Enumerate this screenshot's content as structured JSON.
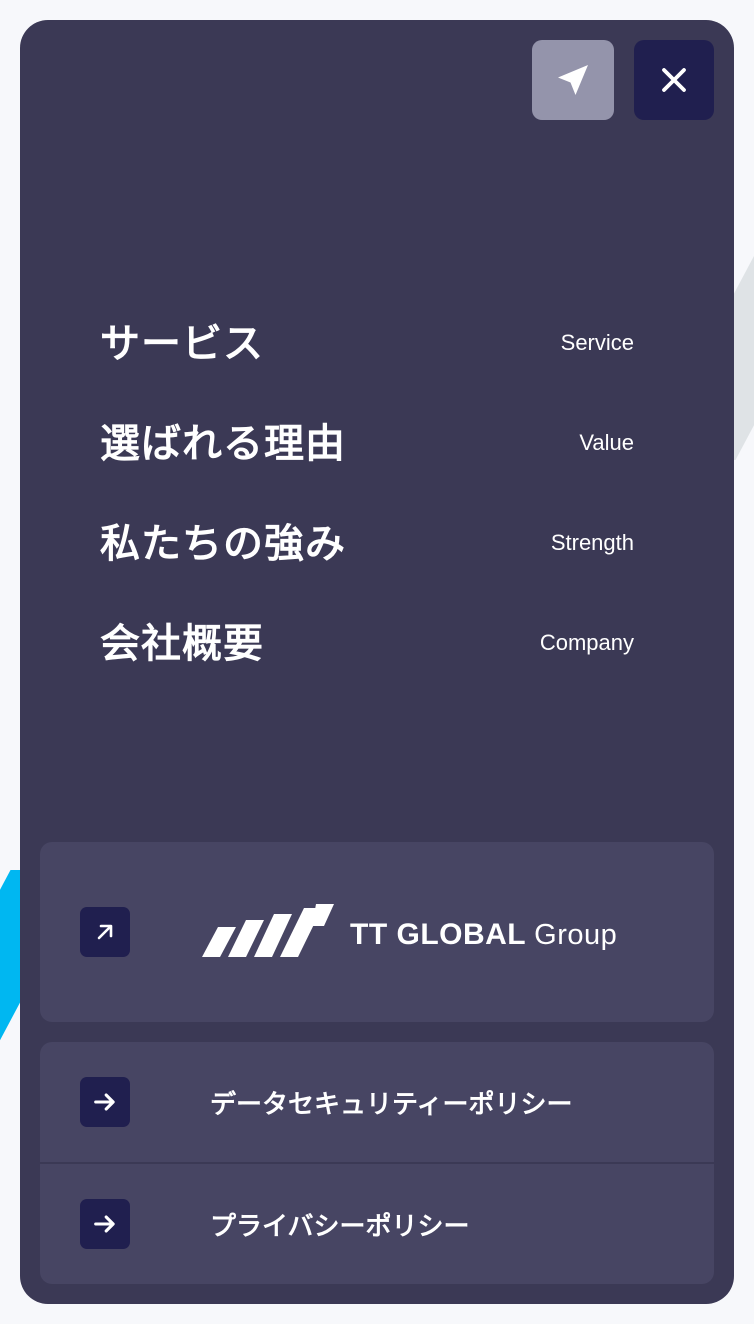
{
  "colors": {
    "panel": "#3b3955",
    "card": "#474563",
    "accent_dark": "#201f4f",
    "send_button": "#9494ab",
    "stripe_blue": "#00b7f1",
    "stripe_grey": "#dfe3e6"
  },
  "header": {
    "send_icon": "paper-plane-icon",
    "close_icon": "close-icon"
  },
  "nav": {
    "items": [
      {
        "jp": "サービス",
        "en": "Service"
      },
      {
        "jp": "選ばれる理由",
        "en": "Value"
      },
      {
        "jp": "私たちの強み",
        "en": "Strength"
      },
      {
        "jp": "会社概要",
        "en": "Company"
      }
    ]
  },
  "group_link": {
    "icon": "external-arrow-icon",
    "logo_bold": "TT GLOBAL",
    "logo_light": "Group"
  },
  "policy_links": [
    {
      "icon": "arrow-right-icon",
      "label": "データセキュリティーポリシー"
    },
    {
      "icon": "arrow-right-icon",
      "label": "プライバシーポリシー"
    }
  ]
}
